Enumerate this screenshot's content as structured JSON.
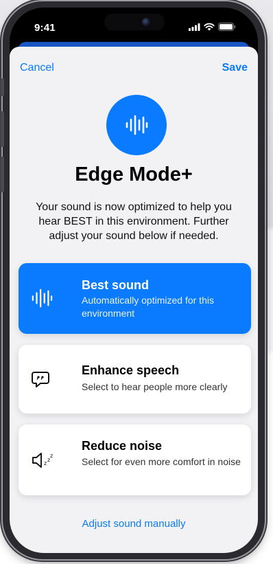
{
  "status_bar": {
    "time": "9:41"
  },
  "nav": {
    "cancel": "Cancel",
    "save": "Save"
  },
  "hero": {
    "icon": "sound-wave-icon",
    "title": "Edge Mode+",
    "description": "Your sound is now optimized to help you hear BEST in this environment. Further adjust your sound below if needed."
  },
  "options": [
    {
      "icon": "sound-wave-icon",
      "title": "Best sound",
      "subtitle": "Automatically optimized for this environment",
      "selected": true
    },
    {
      "icon": "speech-bubble-icon",
      "title": "Enhance speech",
      "subtitle": "Select to hear people more clearly",
      "selected": false
    },
    {
      "icon": "speaker-zzz-icon",
      "title": "Reduce noise",
      "subtitle": "Select for even more comfort in noise",
      "selected": false
    }
  ],
  "footer": {
    "adjust_link": "Adjust sound manually"
  },
  "colors": {
    "accent": "#0a7aff",
    "sheet_background": "#f2f2f5"
  }
}
